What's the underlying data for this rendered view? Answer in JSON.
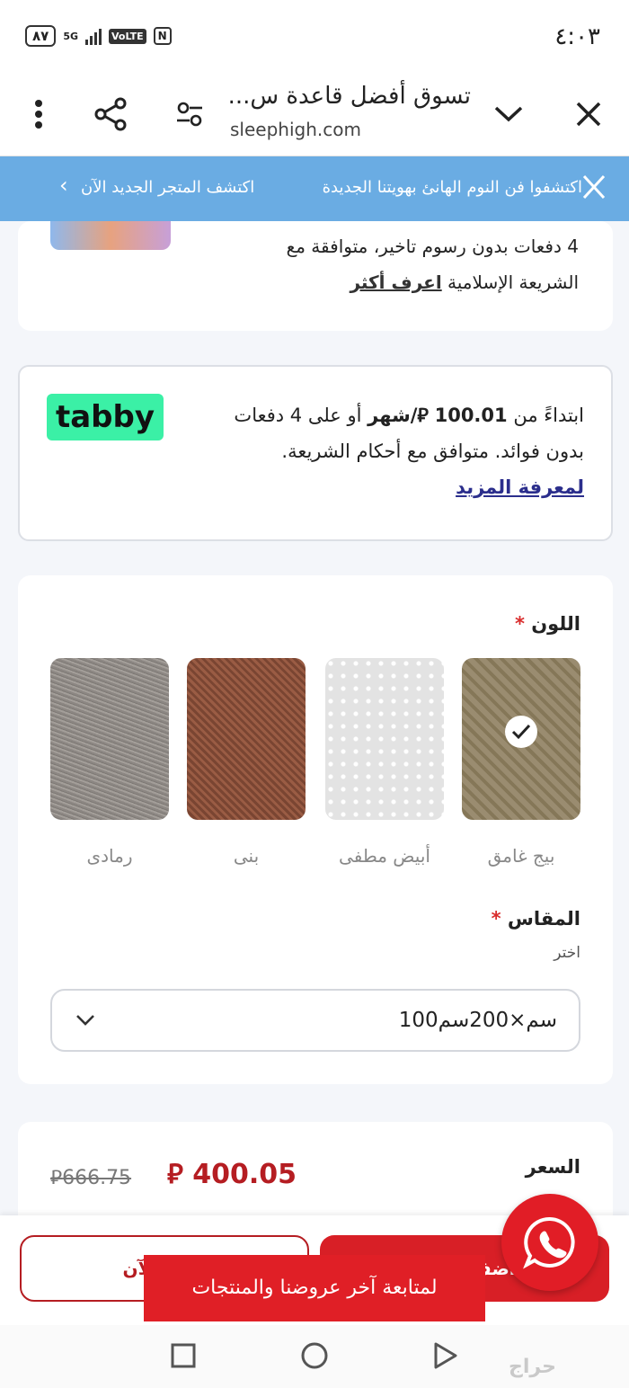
{
  "status_bar": {
    "time": "٤:٠٣",
    "battery": "٨٧",
    "network": "5G",
    "volte": "VoLTE",
    "nfc": "N"
  },
  "browser": {
    "title": "تسوق أفضل قاعدة س...",
    "url": "sleephigh.com"
  },
  "banner": {
    "text_main": "اكتشفوا فن النوم الهانئ بهويتنا الجديدة",
    "text_cta": "اكتشف المتجر الجديد الآن"
  },
  "tamara": {
    "line1": "4 دفعات بدون رسوم تاخير، متوافقة مع",
    "line2": "الشريعة الإسلامية",
    "link": "اعرف أكثر"
  },
  "tabby": {
    "logo": "tabby",
    "prefix": "ابتداءً من",
    "amount": "100.01",
    "per": "/شهر",
    "suffix": "أو على 4 دفعات",
    "line2": "بدون فوائد. متوافق مع أحكام الشريعة.",
    "link": "لمعرفة المزيد"
  },
  "color_option": {
    "label": "اللون",
    "required": "*",
    "swatches": [
      {
        "name": "بيج غامق",
        "selected": true
      },
      {
        "name": "أبيض مطفى",
        "selected": false
      },
      {
        "name": "بنى",
        "selected": false
      },
      {
        "name": "رمادى",
        "selected": false
      }
    ]
  },
  "size_option": {
    "label": "المقاس",
    "required": "*",
    "hint": "اختر",
    "selected": "100سم×200سم"
  },
  "price": {
    "label": "السعر",
    "current": "400.05",
    "old": "666.75",
    "currency_symbol": "⃁"
  },
  "buttons": {
    "buy_now": "اشتر الآن",
    "add_to_cart": "أضف للسلة"
  },
  "toast": {
    "text": "لمتابعة آخر عروضنا والمنتجات"
  },
  "watermark": {
    "text": "حراج"
  },
  "colors": {
    "brand_red": "#d81f26",
    "banner_blue": "#6aace3",
    "tabby_green": "#3bf0a6",
    "link_navy": "#2b2e8c"
  }
}
